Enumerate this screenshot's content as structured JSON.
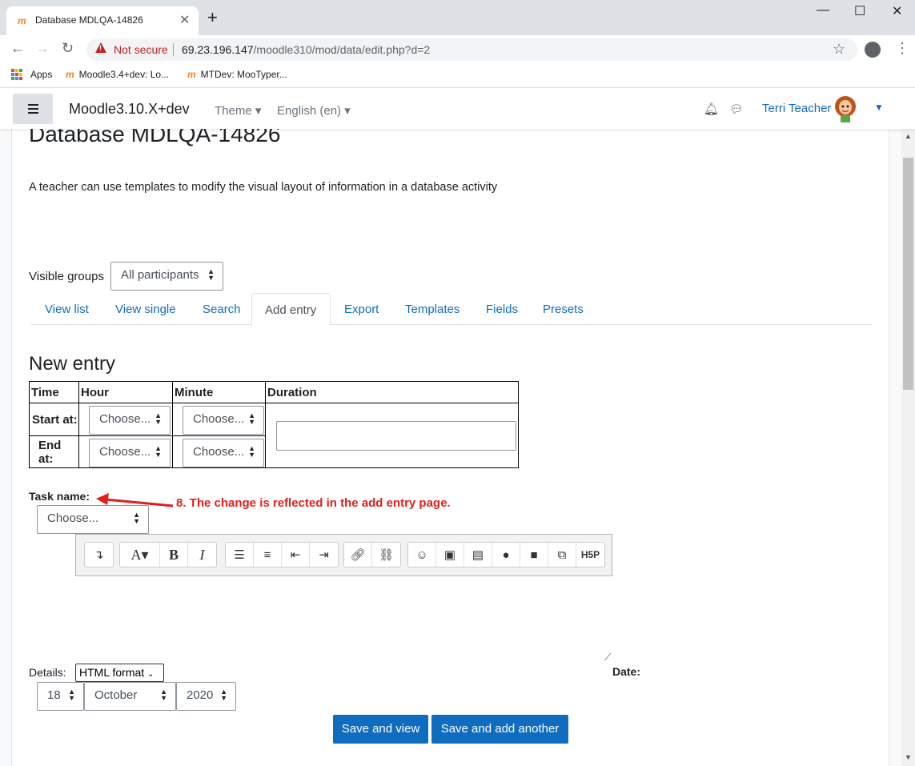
{
  "browser": {
    "tab_title": "Database MDLQA-14826",
    "tab_close": "✕",
    "new_tab": "+",
    "window_controls": [
      "—",
      "☐",
      "✕"
    ],
    "security_label": "Not secure",
    "url_host": "69.23.196.147",
    "url_path": "/moodle310/mod/data/edit.php?d=2",
    "bookmarks": [
      "Apps",
      "Moodle3.4+dev: Lo...",
      "MTDev: MooTyper..."
    ]
  },
  "navbar": {
    "site_name": "Moodle3.10.X+dev",
    "theme_label": "Theme",
    "language_label": "English (en)",
    "user_name": "Terri Teacher"
  },
  "page": {
    "title": "Database MDLQA-14826",
    "intro": "A teacher can use templates to modify the visual layout of information in a database activity",
    "visible_groups_label": "Visible groups",
    "visible_groups_value": "All participants",
    "tabs": [
      "View list",
      "View single",
      "Search",
      "Add entry",
      "Export",
      "Templates",
      "Fields",
      "Presets"
    ],
    "active_tab": "Add entry",
    "section_heading": "New entry"
  },
  "entry_table": {
    "headers": [
      "Time",
      "Hour",
      "Minute",
      "Duration"
    ],
    "rows": [
      "Start at:",
      "End at:"
    ],
    "choose_placeholder": "Choose..."
  },
  "task": {
    "label": "Task name:",
    "select_value": "Choose...",
    "annotation": "8. The change is reflected in the add entry page."
  },
  "editor": {
    "toolbar_icons": [
      "collapse-icon",
      "font-color-icon",
      "bold-icon",
      "italic-icon",
      "unordered-list-icon",
      "ordered-list-icon",
      "outdent-icon",
      "indent-icon",
      "link-icon",
      "unlink-icon",
      "emoji-icon",
      "image-icon",
      "media-icon",
      "record-audio-icon",
      "record-video-icon",
      "manage-files-icon",
      "h5p-icon"
    ],
    "h5p_label": "H5P"
  },
  "details": {
    "label": "Details:",
    "format_value": "HTML format",
    "date_label": "Date:",
    "day": "18",
    "month": "October",
    "year": "2020"
  },
  "actions": {
    "save_view": "Save and view",
    "save_add": "Save and add another"
  },
  "colors": {
    "primary": "#0f6cbf",
    "annotation": "#e0201c",
    "not_secure": "#c5221f",
    "moodle_orange": "#f98012"
  }
}
